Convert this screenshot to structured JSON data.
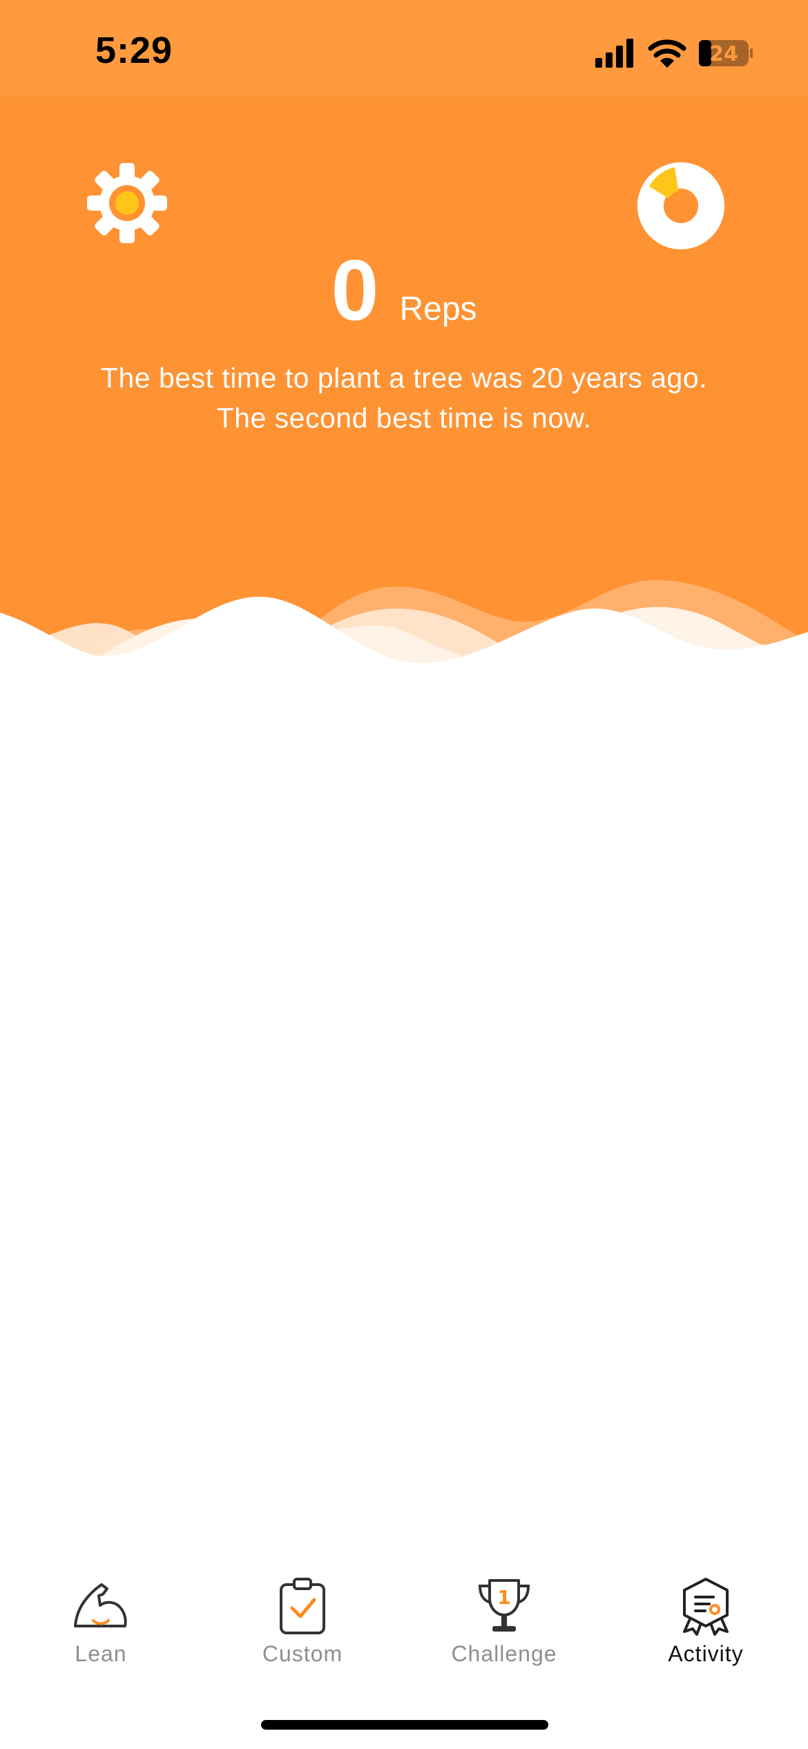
{
  "status_bar": {
    "time": "5:29",
    "battery_level": "24",
    "icons": [
      "cellular-signal-icon",
      "wifi-icon",
      "battery-icon"
    ]
  },
  "header": {
    "settings_icon": "gear-icon",
    "stats_icon": "pie-chart-icon",
    "reps_count": "0",
    "reps_unit": "Reps",
    "quote_line1": "The best time to plant a tree was 20 years ago.",
    "quote_line2": "The second best time is now."
  },
  "tab_bar": {
    "tabs": [
      {
        "label": "Lean",
        "icon": "flexed-arm-icon",
        "active": false
      },
      {
        "label": "Custom",
        "icon": "clipboard-check-icon",
        "active": false
      },
      {
        "label": "Challenge",
        "icon": "trophy-icon",
        "active": false
      },
      {
        "label": "Activity",
        "icon": "badge-icon",
        "active": true
      }
    ]
  },
  "colors": {
    "primary_orange": "#FF9233",
    "accent_yellow": "#FFC61A",
    "active_tab": "#111111",
    "inactive_tab": "#8E8E93"
  }
}
